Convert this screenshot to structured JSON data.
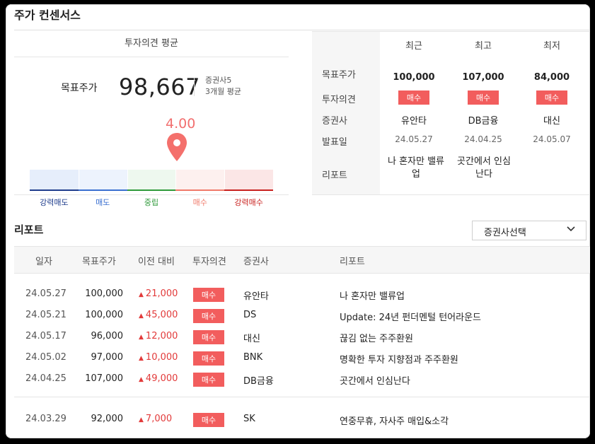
{
  "title": "주가 컨센서스",
  "consensus": {
    "header": "투자의견 평균",
    "target_label": "목표주가",
    "target_value": "98,667",
    "meta_line1": "증권사5",
    "meta_line2": "3개월 평균",
    "score": "4.00",
    "score_value": 4.0,
    "scale": [
      {
        "label": "강력매도",
        "color": "#1e3c8c",
        "bg": "#e6eefb"
      },
      {
        "label": "매도",
        "color": "#3a6fd0",
        "bg": "#edf3fd"
      },
      {
        "label": "중립",
        "color": "#2f9a3a",
        "bg": "#eef8ef"
      },
      {
        "label": "매수",
        "color": "#f07a6a",
        "bg": "#fdf0ef"
      },
      {
        "label": "강력매수",
        "color": "#c8201e",
        "bg": "#fbe6e6"
      }
    ]
  },
  "summary": {
    "columns": [
      "최근",
      "최고",
      "최저"
    ],
    "row_labels": [
      "목표주가",
      "투자의견",
      "증권사",
      "발표일",
      "리포트"
    ],
    "cols": [
      {
        "target": "100,000",
        "opinion": "매수",
        "broker": "유안타",
        "date": "24.05.27",
        "report": "나 혼자만 밸류업"
      },
      {
        "target": "107,000",
        "opinion": "매수",
        "broker": "DB금융",
        "date": "24.04.25",
        "report": "곳간에서 인심난다"
      },
      {
        "target": "84,000",
        "opinion": "매수",
        "broker": "대신",
        "date": "24.05.07",
        "report": ""
      }
    ]
  },
  "reports": {
    "title": "리포트",
    "select_label": "증권사선택",
    "headers": [
      "일자",
      "목표주가",
      "이전 대비",
      "투자의견",
      "증권사",
      "리포트"
    ],
    "rows": [
      {
        "date": "24.05.27",
        "target": "100,000",
        "change": "21,000",
        "opinion": "매수",
        "broker": "유안타",
        "title": "나 혼자만 밸류업"
      },
      {
        "date": "24.05.21",
        "target": "100,000",
        "change": "45,000",
        "opinion": "매수",
        "broker": "DS",
        "title": "Update: 24년 펀더멘털 턴어라운드"
      },
      {
        "date": "24.05.17",
        "target": "96,000",
        "change": "12,000",
        "opinion": "매수",
        "broker": "대신",
        "title": "끊김 없는 주주환원"
      },
      {
        "date": "24.05.02",
        "target": "97,000",
        "change": "10,000",
        "opinion": "매수",
        "broker": "BNK",
        "title": "명확한 투자 지향점과 주주환원"
      },
      {
        "date": "24.04.25",
        "target": "107,000",
        "change": "49,000",
        "opinion": "매수",
        "broker": "DB금융",
        "title": "곳간에서 인심난다"
      },
      {
        "date": "24.03.29",
        "target": "92,000",
        "change": "7,000",
        "opinion": "매수",
        "broker": "SK",
        "title": "연중무휴, 자사주 매입&소각"
      }
    ]
  },
  "colors": {
    "accent": "#f25d5d",
    "rise": "#e23a3a"
  }
}
